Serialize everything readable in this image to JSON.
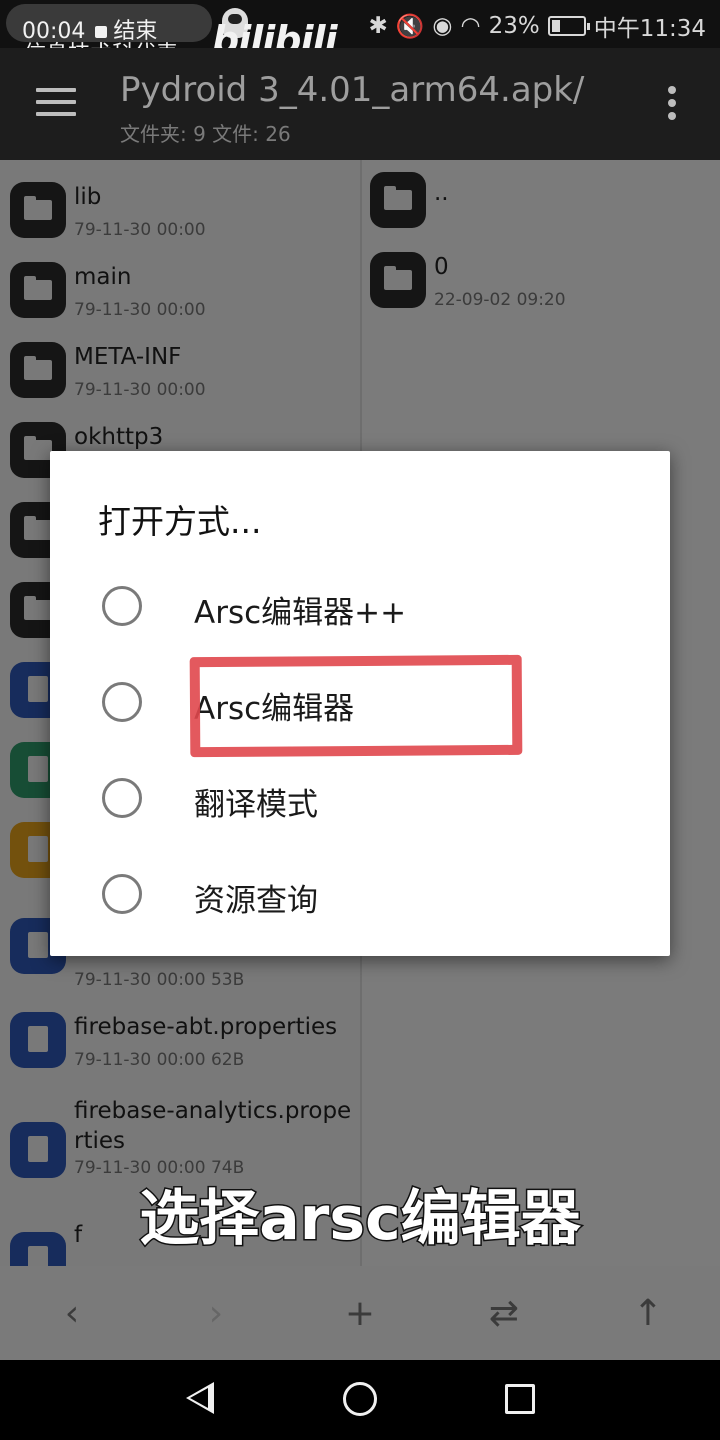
{
  "status_bar": {
    "recording_time": "00:04",
    "recording_end": "结束",
    "channel_name": "信息技术科代表",
    "bili_logo": "bilibili",
    "battery": "23%",
    "clock": "中午11:34"
  },
  "app_bar": {
    "title": "Pydroid 3_4.01_arm64.apk/",
    "subtitle": "文件夹: 9  文件: 26"
  },
  "left_pane": {
    "items": [
      {
        "name": "lib",
        "meta": "79-11-30 00:00",
        "type": "folder"
      },
      {
        "name": "main",
        "meta": "79-11-30 00:00",
        "type": "folder"
      },
      {
        "name": "META-INF",
        "meta": "79-11-30 00:00",
        "type": "folder"
      },
      {
        "name": "okhttp3",
        "meta": "",
        "type": "folder"
      },
      {
        "name": "",
        "meta": "",
        "type": "folder"
      },
      {
        "name": "",
        "meta": "",
        "type": "folder"
      },
      {
        "name": "",
        "meta": "",
        "type": "xml"
      },
      {
        "name": "",
        "meta": "",
        "type": "binary"
      },
      {
        "name": "",
        "meta": "",
        "type": "layers"
      },
      {
        "name": "",
        "meta": "79-11-30 00:00  53B",
        "type": "doc"
      },
      {
        "name": "firebase-abt.properties",
        "meta": "79-11-30 00:00  62B",
        "type": "doc"
      },
      {
        "name": "firebase-analytics.properties",
        "meta": "79-11-30 00:00  74B",
        "type": "doc"
      },
      {
        "name": "f",
        "meta": "",
        "type": "doc"
      }
    ]
  },
  "right_pane": {
    "items": [
      {
        "name": "..",
        "meta": "",
        "type": "folder"
      },
      {
        "name": "0",
        "meta": "22-09-02 09:20",
        "type": "folder"
      }
    ]
  },
  "dialog": {
    "title": "打开方式...",
    "options": [
      {
        "label": "Arsc编辑器++",
        "selected": false
      },
      {
        "label": "Arsc编辑器",
        "selected": false,
        "highlighted": true
      },
      {
        "label": "翻译模式",
        "selected": false
      },
      {
        "label": "资源查询",
        "selected": false
      }
    ]
  },
  "caption": "选择arsc编辑器",
  "toolbar": {
    "back": "‹",
    "forward": "›",
    "add": "+",
    "swap": "⇄",
    "up": "↑"
  },
  "colors": {
    "highlight": "#e0474c",
    "folder_icon": "#2a2a2a",
    "file_icon_blue": "#2e58b8"
  }
}
